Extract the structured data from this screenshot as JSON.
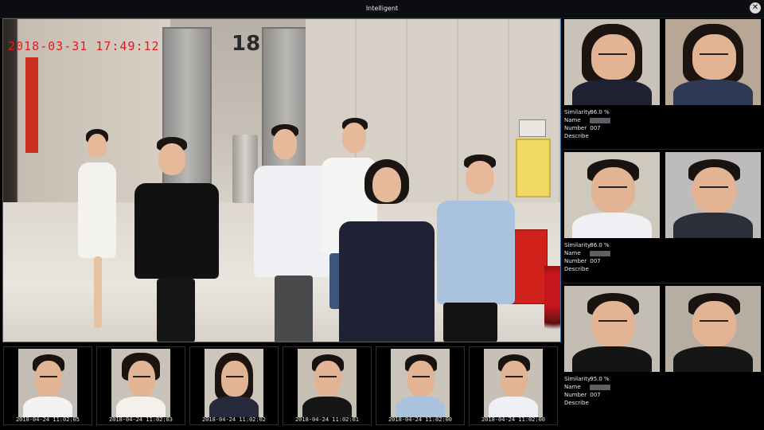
{
  "window": {
    "title": "Intelligent",
    "close_label": "✕"
  },
  "camera": {
    "timestamp": "2018-03-31 17:49:12",
    "floor_label": "18"
  },
  "snapshots": [
    {
      "time": "2018-04-24 11:02:05"
    },
    {
      "time": "2018-04-24 11:02:03"
    },
    {
      "time": "2018-04-24 11:02:02"
    },
    {
      "time": "2018-04-24 11:02:01"
    },
    {
      "time": "2018-04-24 11:02:00"
    },
    {
      "time": "2018-04-24 11:02:00"
    }
  ],
  "matches": [
    {
      "similarity_label": "Similarity",
      "similarity": "86.0 %",
      "name_label": "Name",
      "number_label": "Number",
      "number": "007",
      "describe_label": "Describe"
    },
    {
      "similarity_label": "Similarity",
      "similarity": "86.0 %",
      "name_label": "Name",
      "number_label": "Number",
      "number": "007",
      "describe_label": "Describe"
    },
    {
      "similarity_label": "Similarity",
      "similarity": "95.0 %",
      "name_label": "Name",
      "number_label": "Number",
      "number": "007",
      "describe_label": "Describe"
    }
  ]
}
